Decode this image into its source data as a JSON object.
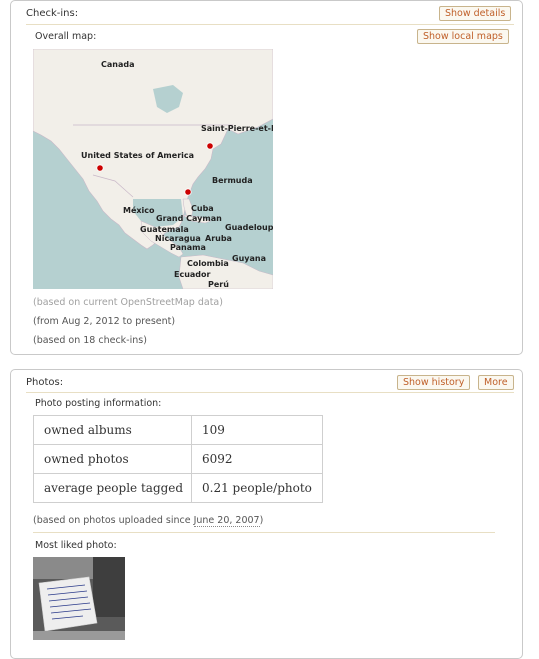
{
  "checkins": {
    "title": "Check-ins:",
    "show_details": "Show details",
    "map_label": "Overall map:",
    "show_local_maps": "Show local maps",
    "map_labels": {
      "canada": "Canada",
      "usa": "United States of America",
      "saint_pierre": "Saint-Pierre-et-M",
      "bermuda": "Bermuda",
      "mexico": "México",
      "cuba": "Cuba",
      "grand_cayman": "Grand Cayman",
      "guadeloupe": "Guadeloupe",
      "guatemala": "Guatemala",
      "nicaragua": "Nicaragua",
      "aruba": "Aruba",
      "panama": "Panama",
      "guyana": "Guyana",
      "colombia": "Colombia",
      "ecuador": "Ecuador",
      "peru": "Perú"
    },
    "map_note": "(based on current OpenStreetMap data)",
    "date_range": "(from Aug 2, 2012 to present)",
    "count_note": "(based on 18 check-ins)"
  },
  "photos": {
    "title": "Photos:",
    "show_history": "Show history",
    "more": "More",
    "posting_label": "Photo posting information:",
    "rows": [
      {
        "key": "owned albums",
        "value": "109"
      },
      {
        "key": "owned photos",
        "value": "6092"
      },
      {
        "key": "average people tagged",
        "value": "0.21 people/photo"
      }
    ],
    "since_prefix": "(based on photos uploaded since ",
    "since_date": "June 20, 2007",
    "since_suffix": ")",
    "most_liked_label": "Most liked photo:"
  },
  "colors": {
    "button_text": "#c0602a",
    "button_border": "#c8b48c",
    "marker": "#cc0000",
    "land": "#f2efe9",
    "water": "#b5d0d0"
  }
}
